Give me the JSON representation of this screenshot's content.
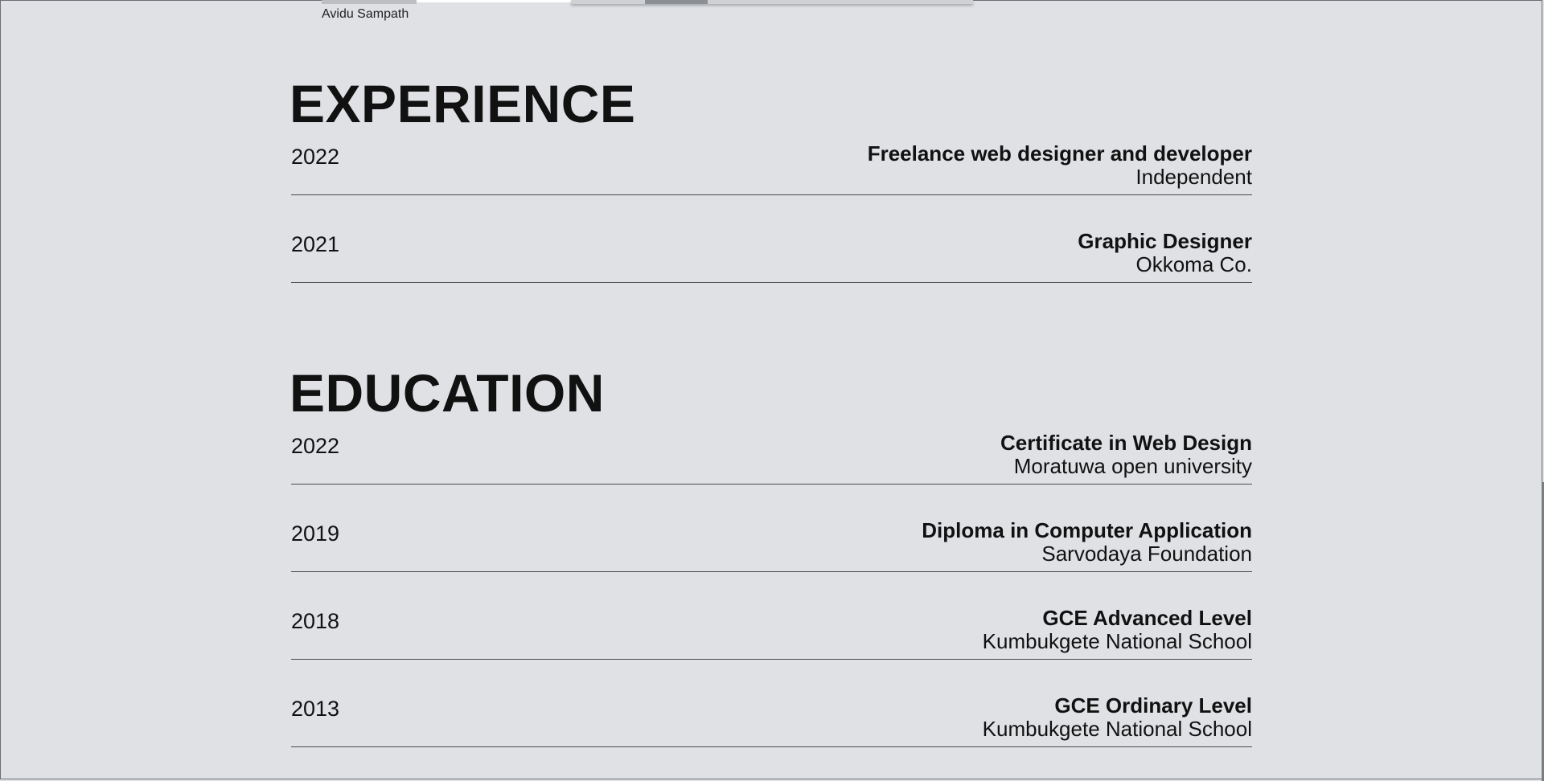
{
  "header": {
    "author": "Avidu Sampath"
  },
  "experience": {
    "title": "EXPERIENCE",
    "items": [
      {
        "year": "2022",
        "role": "Freelance web designer and developer",
        "org": "Independent"
      },
      {
        "year": "2021",
        "role": "Graphic Designer",
        "org": "Okkoma Co."
      }
    ]
  },
  "education": {
    "title": "EDUCATION",
    "items": [
      {
        "year": "2022",
        "role": "Certificate in Web Design",
        "org": "Moratuwa open university"
      },
      {
        "year": "2019",
        "role": "Diploma in Computer Application",
        "org": "Sarvodaya Foundation"
      },
      {
        "year": "2018",
        "role": "GCE Advanced Level",
        "org": "Kumbukgete National School"
      },
      {
        "year": "2013",
        "role": "GCE Ordinary Level",
        "org": "Kumbukgete National School"
      }
    ]
  },
  "colors": {
    "background": "#dfe1e5",
    "text": "#111111",
    "divider": "#4a4a4a"
  }
}
